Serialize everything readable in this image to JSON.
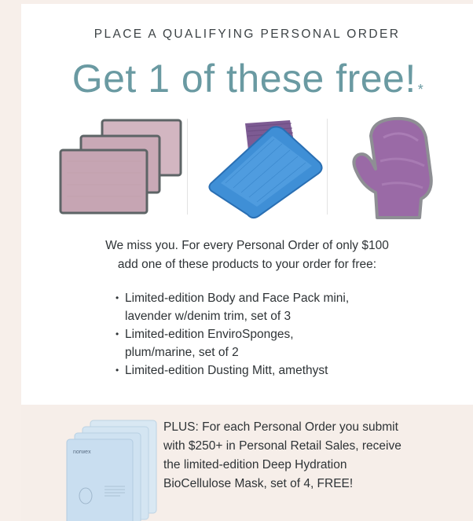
{
  "promo": {
    "eyebrow": "PLACE A QUALIFYING PERSONAL ORDER",
    "headline": "Get 1 of these free!",
    "asterisk": "*"
  },
  "products": [
    {
      "name": "body-and-face-pack-mini",
      "icon": "cloth-stack-icon"
    },
    {
      "name": "envirosponges",
      "icon": "sponge-icon"
    },
    {
      "name": "dusting-mitt",
      "icon": "mitt-icon"
    }
  ],
  "intro": {
    "line1": "We miss you. For every Personal Order of only $100",
    "line2": "add one of these products to your order for free:"
  },
  "bullets": [
    {
      "line1": "Limited-edition Body and Face Pack mini,",
      "line2": "lavender w/denim trim, set of 3"
    },
    {
      "line1": "Limited-edition EnviroSponges,",
      "line2": "plum/marine, set of 2"
    },
    {
      "line1": "Limited-edition Dusting Mitt, amethyst",
      "line2": ""
    }
  ],
  "plus": {
    "line1": "PLUS: For each Personal Order you submit",
    "line2": "with $250+ in Personal Retail Sales, receive",
    "line3": "the limited-edition Deep Hydration",
    "line4": "BioCellulose Mask, set of 4, FREE!",
    "brand": "norwex"
  },
  "colors": {
    "headline": "#6a9aa2",
    "page_bg": "#f7efea",
    "band_bg": "#f6eee9",
    "cloth": "#c9aab6",
    "sponge_blue": "#3f8fd6",
    "sponge_purple": "#7b5a8f",
    "mitt": "#9a6aa6"
  }
}
